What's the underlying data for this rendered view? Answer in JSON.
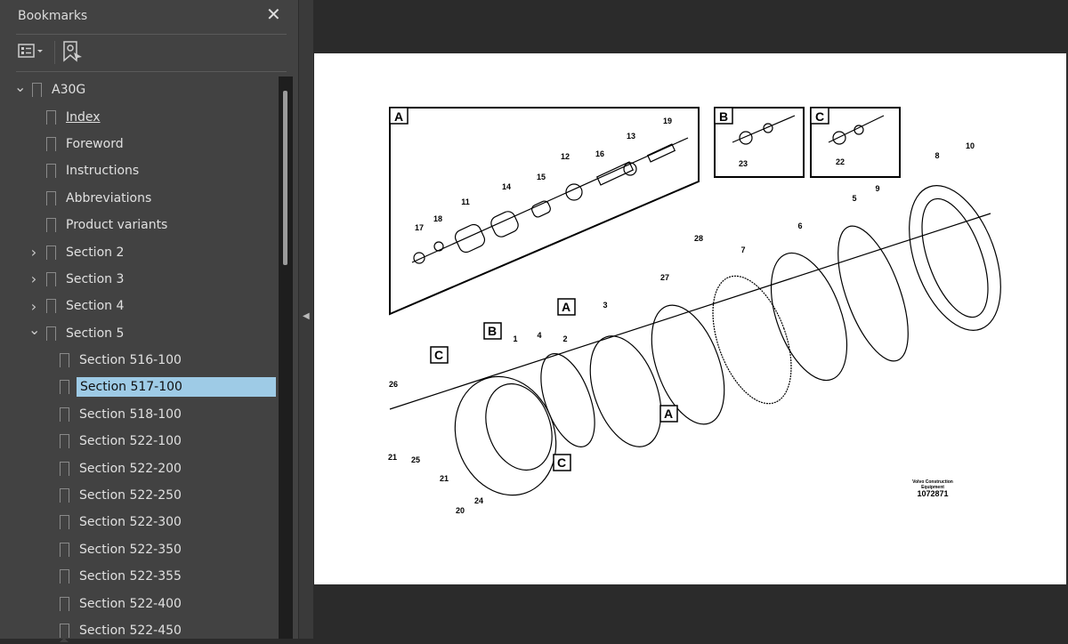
{
  "panel": {
    "title": "Bookmarks",
    "close_icon": "close-icon",
    "options_icon": "list-options-icon",
    "find_bookmark_icon": "find-current-bookmark-icon"
  },
  "tree": [
    {
      "label": "A30G",
      "level": 0,
      "expander": "expanded"
    },
    {
      "label": "Index",
      "level": 1,
      "underlined": true
    },
    {
      "label": "Foreword",
      "level": 1
    },
    {
      "label": "Instructions",
      "level": 1
    },
    {
      "label": "Abbreviations",
      "level": 1
    },
    {
      "label": "Product variants",
      "level": 1
    },
    {
      "label": "Section 2",
      "level": 1,
      "expander": "collapsed"
    },
    {
      "label": "Section 3",
      "level": 1,
      "expander": "collapsed"
    },
    {
      "label": "Section 4",
      "level": 1,
      "expander": "collapsed"
    },
    {
      "label": "Section 5",
      "level": 1,
      "expander": "expanded"
    },
    {
      "label": "Section 516-100",
      "level": 2
    },
    {
      "label": "Section 517-100",
      "level": 2,
      "selected": true
    },
    {
      "label": "Section 518-100",
      "level": 2
    },
    {
      "label": "Section 522-100",
      "level": 2
    },
    {
      "label": "Section 522-200",
      "level": 2
    },
    {
      "label": "Section 522-250",
      "level": 2
    },
    {
      "label": "Section 522-300",
      "level": 2
    },
    {
      "label": "Section 522-350",
      "level": 2
    },
    {
      "label": "Section 522-355",
      "level": 2
    },
    {
      "label": "Section 522-400",
      "level": 2
    },
    {
      "label": "Section 522-450",
      "level": 2
    }
  ],
  "selected_color": "#9ecbe6",
  "diagram": {
    "detail_labels": {
      "a": "A",
      "b": "B",
      "c": "C"
    },
    "callouts": [
      "1",
      "2",
      "3",
      "4",
      "5",
      "6",
      "7",
      "8",
      "9",
      "10",
      "11",
      "12",
      "13",
      "14",
      "15",
      "16",
      "17",
      "18",
      "19",
      "20",
      "21",
      "21",
      "22",
      "23",
      "24",
      "25",
      "26",
      "27",
      "28"
    ],
    "caption_line1": "Volvo Construction",
    "caption_line2": "Equipment",
    "drawing_number": "1072871"
  }
}
